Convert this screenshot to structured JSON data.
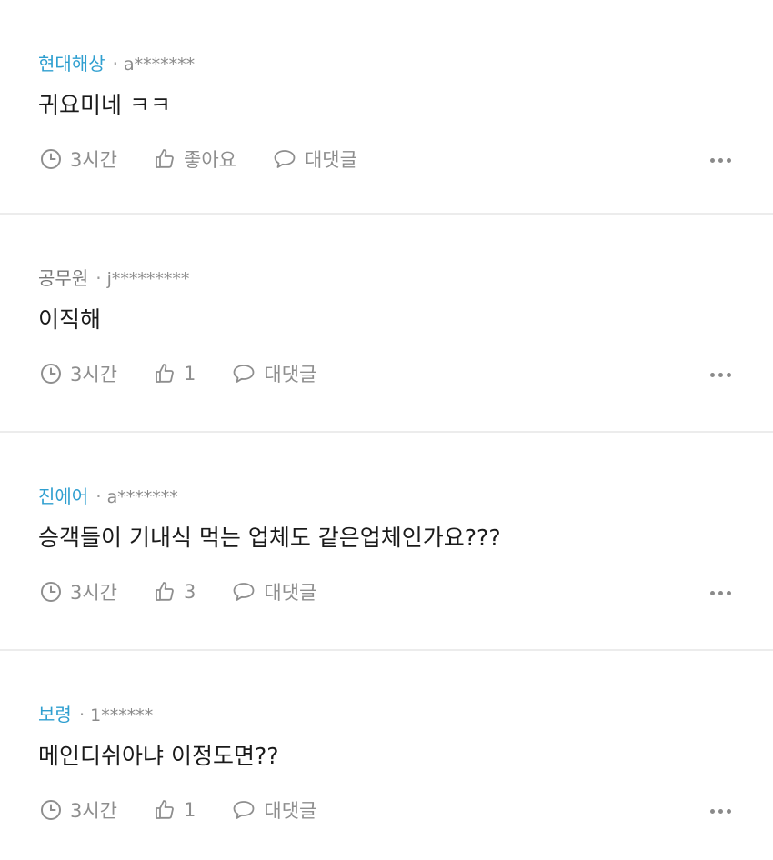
{
  "colors": {
    "company_accent": "#2f9fd0",
    "company_gray": "#777777",
    "meta_text": "#8e8e8e"
  },
  "comments": [
    {
      "company": "현대해상",
      "company_color": "accent",
      "separator": "·",
      "user": "a*******",
      "text": "귀요미네 ㅋㅋ",
      "time": "3시간",
      "likes": "좋아요",
      "reply": "대댓글",
      "icons": [
        "clock-icon",
        "thumbs-up-icon",
        "speech-bubble-icon",
        "more-icon"
      ]
    },
    {
      "company": "공무원",
      "company_color": "gray",
      "separator": "·",
      "user": "j*********",
      "text": "이직해",
      "time": "3시간",
      "likes": "1",
      "reply": "대댓글"
    },
    {
      "company": "진에어",
      "company_color": "accent",
      "separator": "·",
      "user": "a*******",
      "text": "승객들이 기내식 먹는 업체도 같은업체인가요???",
      "time": "3시간",
      "likes": "3",
      "reply": "대댓글"
    },
    {
      "company": "보령",
      "company_color": "accent",
      "separator": "·",
      "user": "1******",
      "text": "메인디쉬아냐 이정도면??",
      "time": "3시간",
      "likes": "1",
      "reply": "대댓글"
    }
  ]
}
